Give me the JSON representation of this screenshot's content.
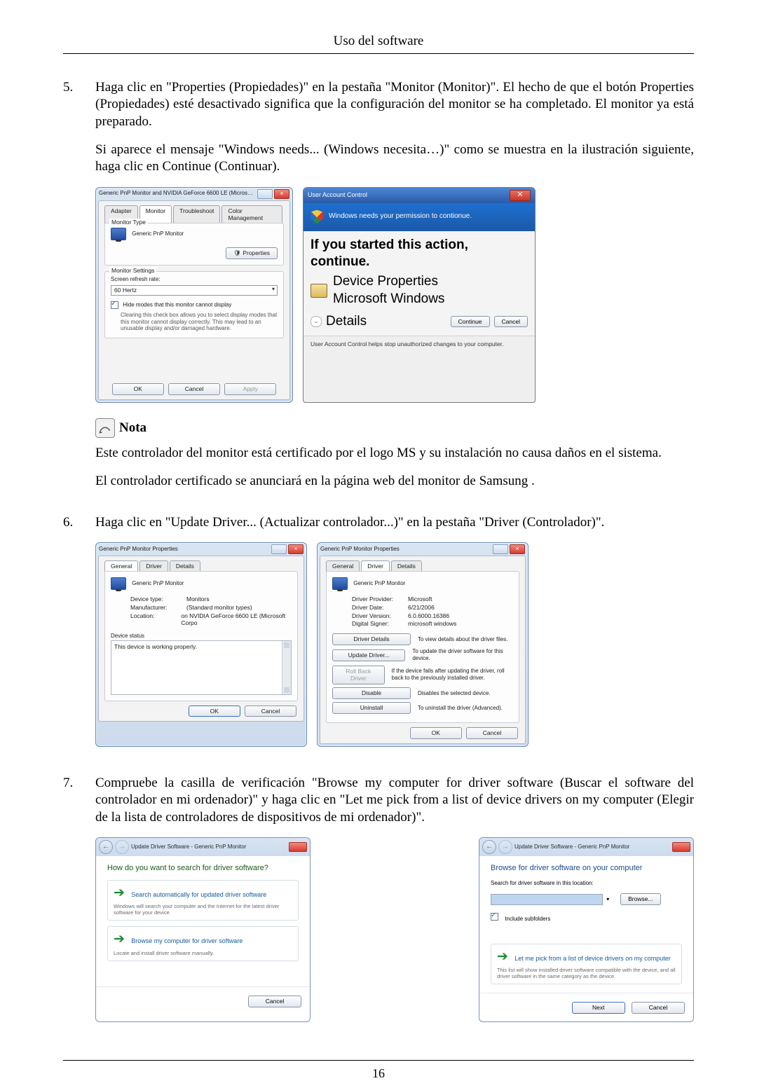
{
  "header": {
    "title": "Uso del software"
  },
  "steps": {
    "s5": {
      "num": "5.",
      "p1": "Haga clic en \"Properties (Propiedades)\" en la pestaña \"Monitor (Monitor)\". El hecho de que el botón Properties (Propiedades) esté desactivado significa que la configuración del monitor se ha completado. El monitor ya está preparado.",
      "p2": "Si aparece el mensaje \"Windows needs... (Windows necesita…)\" como se muestra en la ilustración siguiente, haga clic en Continue (Continuar)."
    },
    "s6": {
      "num": "6.",
      "p1": "Haga clic en \"Update Driver... (Actualizar controlador...)\" en la pestaña \"Driver (Controlador)\"."
    },
    "s7": {
      "num": "7.",
      "p1": "Compruebe la casilla de verificación \"Browse my computer for driver software (Buscar el software del controlador en mi ordenador)\" y haga clic en \"Let me pick from a list of device drivers on my computer (Elegir de la lista de controladores de dispositivos de mi ordenador)\"."
    }
  },
  "note": {
    "label": "Nota",
    "p1": "Este controlador del monitor está certificado por el logo MS y su instalación no causa daños en el sistema.",
    "p2": "El controlador certificado se anunciará en la página web del monitor de Samsung ."
  },
  "fig1": {
    "props_win": {
      "title": "Generic PnP Monitor and NVIDIA GeForce 6600 LE (Microsoft Co...",
      "tabs": {
        "adapter": "Adapter",
        "monitor": "Monitor",
        "troubleshoot": "Troubleshoot",
        "color": "Color Management"
      },
      "grp_type": "Monitor Type",
      "monitor_name": "Generic PnP Monitor",
      "btn_props": "Properties",
      "grp_settings": "Monitor Settings",
      "lbl_refresh": "Screen refresh rate:",
      "refresh_value": "60 Hertz",
      "chk_hide": "Hide modes that this monitor cannot display",
      "hide_note": "Clearing this check box allows you to select display modes that this monitor cannot display correctly. This may lead to an unusable display and/or damaged hardware.",
      "ok": "OK",
      "cancel": "Cancel",
      "apply": "Apply"
    },
    "uac": {
      "title": "User Account Control",
      "banner": "Windows needs your permission to contionue.",
      "started": "If you started this action, continue.",
      "app_name": "Device Properties",
      "publisher": "Microsoft Windows",
      "details": "Details",
      "continue": "Continue",
      "cancel": "Cancel",
      "footer": "User Account Control helps stop unauthorized changes to your computer."
    }
  },
  "fig2": {
    "left": {
      "title": "Generic PnP Monitor Properties",
      "tabs": {
        "general": "General",
        "driver": "Driver",
        "details": "Details"
      },
      "name": "Generic PnP Monitor",
      "kv": {
        "type_k": "Device type:",
        "type_v": "Monitors",
        "man_k": "Manufacturer:",
        "man_v": "(Standard monitor types)",
        "loc_k": "Location:",
        "loc_v": "on NVIDIA GeForce 6600 LE (Microsoft Corpo"
      },
      "grp_status": "Device status",
      "status": "This device is working properly.",
      "ok": "OK",
      "cancel": "Cancel"
    },
    "right": {
      "title": "Generic PnP Monitor Properties",
      "tabs": {
        "general": "General",
        "driver": "Driver",
        "details": "Details"
      },
      "name": "Generic PnP Monitor",
      "kv": {
        "prov_k": "Driver Provider:",
        "prov_v": "Microsoft",
        "date_k": "Driver Date:",
        "date_v": "6/21/2006",
        "ver_k": "Driver Version:",
        "ver_v": "6.0.6000.16386",
        "sig_k": "Digital Signer:",
        "sig_v": "microsoft windows"
      },
      "btn_details": "Driver Details",
      "desc_details": "To view details about the driver files.",
      "btn_update": "Update Driver...",
      "desc_update": "To update the driver software for this device.",
      "btn_rollback": "Roll Back Driver",
      "desc_rollback": "If the device fails after updating the driver, roll back to the previously installed driver.",
      "btn_disable": "Disable",
      "desc_disable": "Disables the selected device.",
      "btn_uninstall": "Uninstall",
      "desc_uninstall": "To uninstall the driver (Advanced).",
      "ok": "OK",
      "cancel": "Cancel"
    }
  },
  "fig3": {
    "left": {
      "crumb": "Update Driver Software - Generic PnP Monitor",
      "heading": "How do you want to search for driver software?",
      "opt1_t": "Search automatically for updated driver software",
      "opt1_d": "Windows will search your computer and the Internet for the latest driver software for your device.",
      "opt2_t": "Browse my computer for driver software",
      "opt2_d": "Locate and install driver software manually.",
      "cancel": "Cancel"
    },
    "right": {
      "crumb": "Update Driver Software - Generic PnP Monitor",
      "heading": "Browse for driver software on your computer",
      "lbl_search": "Search for driver software in this location:",
      "browse": "Browse...",
      "chk_sub": "Include subfolders",
      "opt_t": "Let me pick from a list of device drivers on my computer",
      "opt_d": "This list will show installed driver software compatible with the device, and all driver software in the same category as the device.",
      "next": "Next",
      "cancel": "Cancel"
    }
  },
  "page_number": "16"
}
